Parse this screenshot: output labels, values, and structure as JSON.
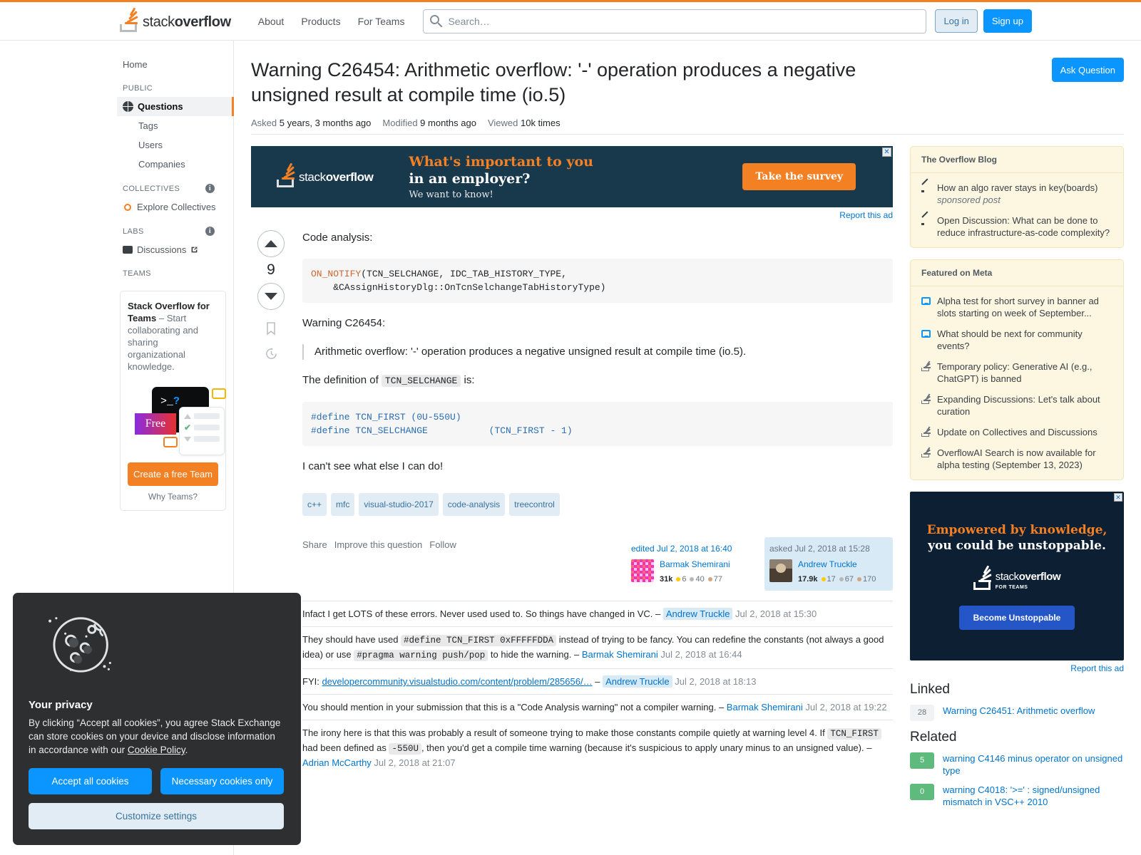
{
  "header": {
    "logo_light": "stack",
    "logo_bold": "overflow",
    "nav": [
      {
        "label": "About"
      },
      {
        "label": "Products"
      },
      {
        "label": "For Teams"
      }
    ],
    "search_placeholder": "Search…",
    "search_value": "",
    "login_label": "Log in",
    "signup_label": "Sign up"
  },
  "sidebar": {
    "home_label": "Home",
    "public_header": "PUBLIC",
    "public_items": [
      {
        "label": "Questions",
        "selected": true
      },
      {
        "label": "Tags",
        "selected": false
      },
      {
        "label": "Users",
        "selected": false
      },
      {
        "label": "Companies",
        "selected": false
      }
    ],
    "collectives_header": "COLLECTIVES",
    "collectives_item": "Explore Collectives",
    "labs_header": "LABS",
    "labs_item": "Discussions",
    "teams_header": "TEAMS",
    "teams_card": {
      "title_bold": "Stack Overflow for Teams",
      "title_rest": " – Start collaborating and sharing organizational knowledge.",
      "free_badge": "Free",
      "terminal_prompt": ">_",
      "terminal_mark": "?",
      "cta": "Create a free Team",
      "why": "Why Teams?"
    }
  },
  "question": {
    "title": "Warning C26454: Arithmetic overflow: '-' operation produces a negative unsigned result at compile time (io.5)",
    "ask_button": "Ask Question",
    "meta": {
      "asked_label": "Asked",
      "asked_value": "5 years, 3 months ago",
      "modified_label": "Modified",
      "modified_value": "9 months ago",
      "viewed_label": "Viewed",
      "viewed_value": "10k times"
    },
    "vote_count": "9",
    "body": {
      "para1": "Code analysis:",
      "code1_fn": "ON_NOTIFY",
      "code1_rest": "(TCN_SELCHANGE, IDC_TAB_HISTORY_TYPE,\n    &CAssignHistoryDlg::OnTcnSelchangeTabHistoryType)",
      "para2": "Warning C26454:",
      "quote": "Arithmetic overflow: '-' operation produces a negative unsigned result at compile time (io.5).",
      "para3_pre": "The definition of ",
      "para3_code": "TCN_SELCHANGE",
      "para3_post": " is:",
      "code2": "#define TCN_FIRST (0U-550U)\n#define TCN_SELCHANGE           (TCN_FIRST - 1)",
      "para4": "I can't see what else I can do!"
    },
    "tags": [
      "c++",
      "mfc",
      "visual-studio-2017",
      "code-analysis",
      "treecontrol"
    ],
    "footer": {
      "share": "Share",
      "improve": "Improve this question",
      "follow": "Follow",
      "edited": {
        "date": "edited Jul 2, 2018 at 16:40",
        "user": "Barmak Shemirani",
        "rep": "31k",
        "gold": "6",
        "silver": "40",
        "bronze": "77"
      },
      "asked": {
        "date": "asked Jul 2, 2018 at 15:28",
        "user": "Andrew Truckle",
        "rep": "17.9k",
        "gold": "17",
        "silver": "67",
        "bronze": "170"
      }
    }
  },
  "comments": [
    {
      "text_parts": [
        {
          "t": "text",
          "v": "Infact I get LOTS of these errors. Never used used to. So things have changed in VC. – "
        },
        {
          "t": "user-hl",
          "v": "Andrew Truckle"
        },
        {
          "t": "date",
          "v": " Jul 2, 2018 at 15:30"
        }
      ]
    },
    {
      "text_parts": [
        {
          "t": "text",
          "v": "They should have used "
        },
        {
          "t": "code",
          "v": "#define TCN_FIRST 0xFFFFFDDA"
        },
        {
          "t": "text",
          "v": " instead of trying to be fancy. You can redefine the constants (not always a good idea) or use "
        },
        {
          "t": "code",
          "v": "#pragma warning push/pop"
        },
        {
          "t": "text",
          "v": " to hide the warning. – "
        },
        {
          "t": "user",
          "v": "Barmak Shemirani"
        },
        {
          "t": "date",
          "v": " Jul 2, 2018 at 16:44"
        }
      ]
    },
    {
      "text_parts": [
        {
          "t": "text",
          "v": "FYI: "
        },
        {
          "t": "link",
          "v": "developercommunity.visualstudio.com/content/problem/285656/…"
        },
        {
          "t": "text",
          "v": " – "
        },
        {
          "t": "user-hl",
          "v": "Andrew Truckle"
        },
        {
          "t": "date",
          "v": " Jul 2, 2018 at 18:13"
        }
      ]
    },
    {
      "text_parts": [
        {
          "t": "text",
          "v": "You should mention in your submission that this is a \"Code Analysis warning\" not a compiler warning. – "
        },
        {
          "t": "user",
          "v": "Barmak Shemirani"
        },
        {
          "t": "date",
          "v": " Jul 2, 2018 at 19:22"
        }
      ]
    },
    {
      "text_parts": [
        {
          "t": "text",
          "v": "The irony here is that this was probably a result of someone trying to make those constants compile quietly at warning level 4. If "
        },
        {
          "t": "code",
          "v": "TCN_FIRST"
        },
        {
          "t": "text",
          "v": " had been defined as "
        },
        {
          "t": "code",
          "v": "-550U"
        },
        {
          "t": "text",
          "v": ", then you'd get a compile time warning (because it's suspicious to apply unary minus to an unsigned value). – "
        },
        {
          "t": "user",
          "v": "Adrian McCarthy"
        },
        {
          "t": "date",
          "v": " Jul 2, 2018 at 21:07"
        }
      ]
    }
  ],
  "banner_ad": {
    "logo_light": "stack",
    "logo_bold": "overflow",
    "line1": "What's important to you",
    "line2": "in an employer?",
    "line3": "We want to know!",
    "cta": "Take the survey",
    "close": "✕",
    "report": "Report this ad"
  },
  "right": {
    "blog": {
      "heading": "The Overflow Blog",
      "items": [
        {
          "title": "How an algo raver stays in key(boards)",
          "sub": "sponsored post",
          "icon": "pen-icon"
        },
        {
          "title": "Open Discussion: What can be done to reduce infrastructure-as-code complexity?",
          "sub": "",
          "icon": "pen-icon"
        }
      ]
    },
    "meta": {
      "heading": "Featured on Meta",
      "items": [
        {
          "title": "Alpha test for short survey in banner ad slots starting on week of September...",
          "icon": "chat-icon"
        },
        {
          "title": "What should be next for community events?",
          "icon": "chat-icon"
        },
        {
          "title": "Temporary policy: Generative AI (e.g., ChatGPT) is banned",
          "icon": "stack-icon"
        },
        {
          "title": "Expanding Discussions: Let's talk about curation",
          "icon": "stack-icon"
        },
        {
          "title": "Update on Collectives and Discussions",
          "icon": "stack-icon"
        },
        {
          "title": "OverflowAI Search is now available for alpha testing (September 13, 2023)",
          "icon": "stack-icon"
        }
      ]
    },
    "ad": {
      "line1": "Empowered by knowledge,",
      "line2": "you could be unstoppable.",
      "logo_light": "stack",
      "logo_bold": "overflow",
      "logo_sub": "FOR TEAMS",
      "cta": "Become Unstoppable",
      "close": "✕",
      "report": "Report this ad"
    },
    "linked": {
      "heading": "Linked",
      "items": [
        {
          "count": "28",
          "title": "Warning C26451: Arithmetic overflow",
          "green": false
        }
      ]
    },
    "related": {
      "heading": "Related",
      "items": [
        {
          "count": "5",
          "title": "warning C4146 minus operator on unsigned type",
          "green": true
        },
        {
          "count": "0",
          "title": "warning C4018: '>=' : signed/unsigned mismatch in VSC++ 2010",
          "green": true
        }
      ]
    }
  },
  "cookie": {
    "title": "Your privacy",
    "body_pre": "By clicking “Accept all cookies”, you agree Stack Exchange can store cookies on your device and disclose information in accordance with our ",
    "policy_link": "Cookie Policy",
    "body_post": ".",
    "accept": "Accept all cookies",
    "necessary": "Necessary cookies only",
    "customize": "Customize settings"
  }
}
